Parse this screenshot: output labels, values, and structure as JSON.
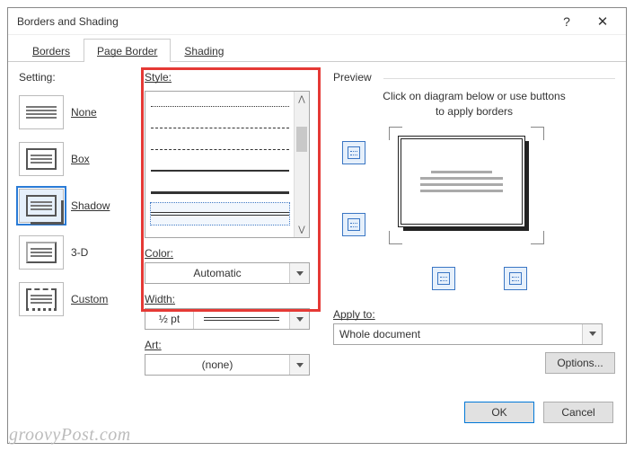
{
  "window": {
    "title": "Borders and Shading",
    "help_glyph": "?",
    "close_glyph": "✕"
  },
  "tabs": {
    "borders": "Borders",
    "page_border": "Page Border",
    "shading": "Shading",
    "active": "page_border"
  },
  "setting": {
    "label": "Setting:",
    "items": [
      {
        "id": "none",
        "label": "None"
      },
      {
        "id": "box",
        "label": "Box"
      },
      {
        "id": "shadow",
        "label": "Shadow"
      },
      {
        "id": "3d",
        "label": "3-D"
      },
      {
        "id": "custom",
        "label": "Custom"
      }
    ],
    "selected": "shadow"
  },
  "style": {
    "label": "Style:",
    "selected_index": 5,
    "options_desc": [
      "fine-dots",
      "dash-dot",
      "dash-dot-dot",
      "solid-medium",
      "solid-heavy",
      "double"
    ]
  },
  "color": {
    "label": "Color:",
    "value": "Automatic"
  },
  "width": {
    "label": "Width:",
    "value": "½ pt"
  },
  "art": {
    "label": "Art:",
    "value": "(none)"
  },
  "preview": {
    "label": "Preview",
    "hint_line1": "Click on diagram below or use buttons",
    "hint_line2": "to apply borders"
  },
  "apply_to": {
    "label": "Apply to:",
    "value": "Whole document"
  },
  "buttons": {
    "options": "Options...",
    "ok": "OK",
    "cancel": "Cancel"
  },
  "watermark": "groovyPost.com"
}
